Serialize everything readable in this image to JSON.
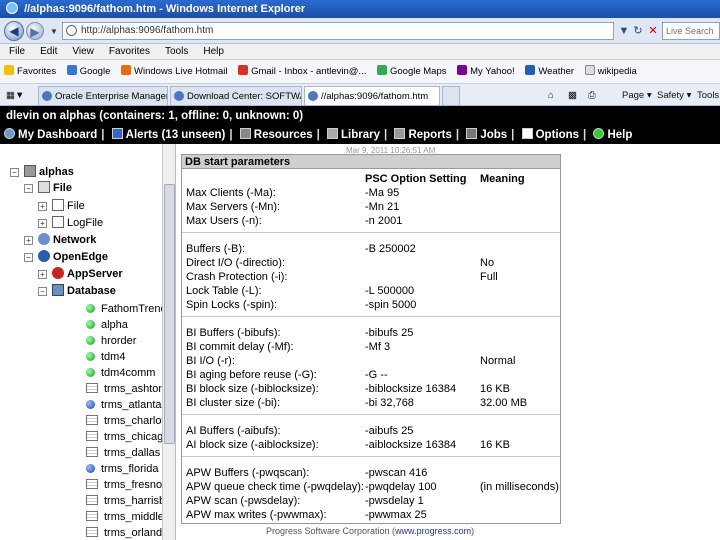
{
  "window": {
    "title": "//alphas:9096/fathom.htm - Windows Internet Explorer"
  },
  "address": {
    "url": "http://alphas:9096/fathom.htm",
    "search_placeholder": "Live Search",
    "back_icon": "back-arrow-icon",
    "forward_icon": "forward-arrow-icon"
  },
  "menu": [
    "File",
    "Edit",
    "View",
    "Favorites",
    "Tools",
    "Help"
  ],
  "favorites": [
    "Favorites",
    "Google",
    "Windows Live Hotmail",
    "Gmail - Inbox - antlevin@...",
    "Google Maps",
    "My Yahoo!",
    "Weather",
    "wikipedia"
  ],
  "tabs": {
    "items": [
      "Oracle Enterprise Manager (...",
      "Download Center: SOFTWA...",
      "//alphas:9096/fathom.htm"
    ],
    "page_label": "Page",
    "safety_label": "Safety",
    "tools_label": "Tools"
  },
  "app": {
    "status": "dlevin on alphas (containers: 1, offline: 0, unknown: 0)",
    "nav": [
      "My Dashboard",
      "Alerts (13 unseen)",
      "Resources",
      "Library",
      "Reports",
      "Jobs",
      "Options",
      "Help"
    ]
  },
  "tree": {
    "root": "alphas",
    "file": "File",
    "file_child": "File",
    "logfile": "LogFile",
    "network": "Network",
    "openedge": "OpenEdge",
    "appserver": "AppServer",
    "database": "Database",
    "databases": [
      {
        "name": "FathomTrend",
        "status": "green"
      },
      {
        "name": "alpha",
        "status": "green"
      },
      {
        "name": "hrorder",
        "status": "green"
      },
      {
        "name": "tdm4",
        "status": "green"
      },
      {
        "name": "tdm4comm",
        "status": "green"
      },
      {
        "name": "trms_ashton",
        "status": "blue"
      },
      {
        "name": "trms_atlanta",
        "status": "blue"
      },
      {
        "name": "trms_charlott",
        "status": "blue"
      },
      {
        "name": "trms_chicago",
        "status": "blue"
      },
      {
        "name": "trms_dallas",
        "status": "blue"
      },
      {
        "name": "trms_florida",
        "status": "blue"
      },
      {
        "name": "trms_fresno",
        "status": "blue"
      },
      {
        "name": "trms_harrisbu",
        "status": "blue"
      },
      {
        "name": "trms_middlet",
        "status": "blue"
      },
      {
        "name": "trms_orlando",
        "status": "blue"
      }
    ]
  },
  "params": {
    "title": "DB start parameters",
    "faded_text": "Mar 9, 2011 10:26:51 AM",
    "headers": [
      "",
      "PSC Option Setting",
      "Meaning"
    ],
    "groups": [
      [
        [
          "Max Clients (-Ma):",
          "-Ma 95",
          ""
        ],
        [
          "Max Servers (-Mn):",
          "-Mn 21",
          ""
        ],
        [
          "Max Users (-n):",
          "-n 2001",
          ""
        ]
      ],
      [
        [
          "Buffers (-B):",
          "-B 250002",
          ""
        ],
        [
          "Direct I/O (-directio):",
          "",
          "No"
        ],
        [
          "Crash Protection (-i):",
          "",
          "Full"
        ],
        [
          "Lock Table (-L):",
          "-L 500000",
          ""
        ],
        [
          "Spin Locks (-spin):",
          "-spin 5000",
          ""
        ]
      ],
      [
        [
          "BI Buffers (-bibufs):",
          "-bibufs 25",
          ""
        ],
        [
          "BI commit delay (-Mf):",
          "-Mf 3",
          ""
        ],
        [
          "BI I/O (-r):",
          "",
          "Normal"
        ],
        [
          "BI aging before reuse (-G):",
          "-G --",
          ""
        ],
        [
          "BI block size (-biblocksize):",
          "-biblocksize 16384",
          "16 KB"
        ],
        [
          "BI cluster size (-bi):",
          "-bi 32,768",
          "32.00 MB"
        ]
      ],
      [
        [
          "AI Buffers (-aibufs):",
          "-aibufs 25",
          ""
        ],
        [
          "AI block size (-aiblocksize):",
          "-aiblocksize 16384",
          "16 KB"
        ]
      ],
      [
        [
          "APW Buffers (-pwqscan):",
          "-pwscan 416",
          ""
        ],
        [
          "APW queue check time (-pwqdelay):",
          "-pwqdelay 100",
          "(in milliseconds)"
        ],
        [
          "APW scan (-pwsdelay):",
          "-pwsdelay 1",
          ""
        ],
        [
          "APW max writes (-pwwmax):",
          "-pwwmax 25",
          ""
        ]
      ]
    ]
  },
  "footer": {
    "text": "Progress Software Corporation (",
    "link": "www.progress.com",
    "end": ")"
  }
}
